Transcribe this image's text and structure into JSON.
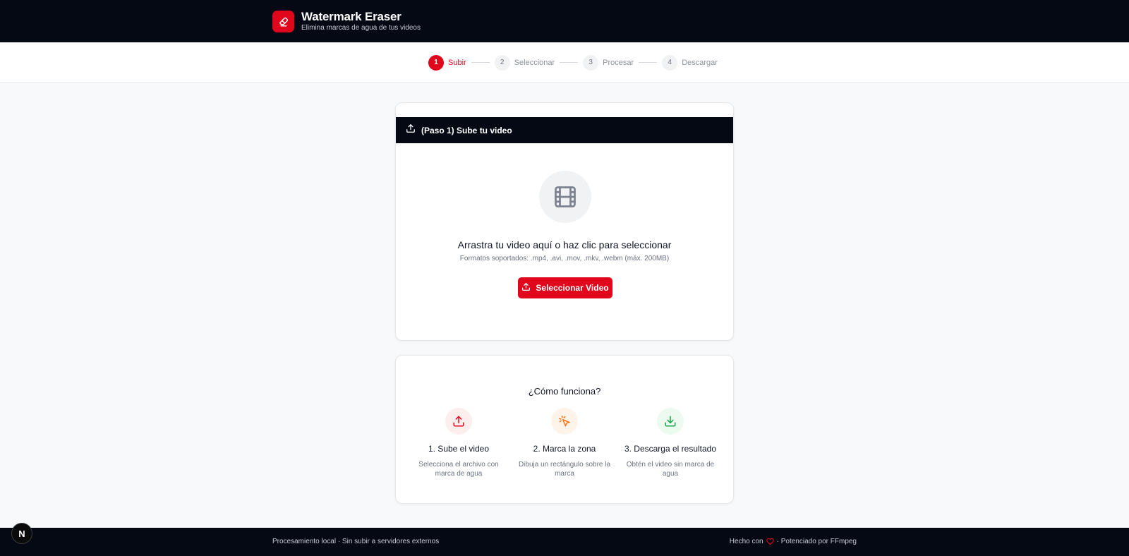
{
  "brand": {
    "title": "Watermark Eraser",
    "subtitle": "Elimina marcas de agua de tus videos",
    "accent": "#e0061c"
  },
  "stepper": {
    "steps": [
      {
        "number": "1",
        "label": "Subir",
        "active": true
      },
      {
        "number": "2",
        "label": "Seleccionar",
        "active": false
      },
      {
        "number": "3",
        "label": "Procesar",
        "active": false
      },
      {
        "number": "4",
        "label": "Descargar",
        "active": false
      }
    ]
  },
  "upload": {
    "header": "(Paso 1) Sube tu video",
    "icon": "film-icon",
    "drop_title": "Arrastra tu video aquí o haz clic para seleccionar",
    "drop_subtitle": "Formatos soportados: .mp4, .avi, .mov, .mkv, .webm (máx. 200MB)",
    "button_label": "Seleccionar Video"
  },
  "how": {
    "title": "¿Cómo funciona?",
    "items": [
      {
        "icon": "upload-icon",
        "title": "1. Sube el video",
        "desc": "Selecciona el archivo con marca de agua",
        "color": "#e0061c",
        "bg": "#fdeeee"
      },
      {
        "icon": "pointer-click-icon",
        "title": "2. Marca la zona",
        "desc": "Dibuja un rectángulo sobre la marca",
        "color": "#f97316",
        "bg": "#fff3ea"
      },
      {
        "icon": "download-icon",
        "title": "3. Descarga el resultado",
        "desc": "Obtén el video sin marca de agua",
        "color": "#16a34a",
        "bg": "#ecfaf0"
      }
    ]
  },
  "footer": {
    "left": "Procesamiento local · Sin subir a servidores externos",
    "right_prefix": "Hecho con",
    "right_suffix": "· Potenciado por FFmpeg"
  },
  "dev_badge": "N"
}
